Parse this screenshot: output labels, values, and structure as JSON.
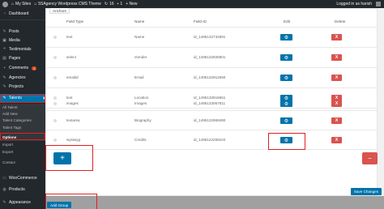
{
  "admin_bar": {
    "site_name": "My Sites",
    "theme_name": "5SAgency Wordpress CMS Theme",
    "updates_count": "16",
    "comments_count": "1",
    "new_label": "+ New",
    "greeting": "Logged in as harish"
  },
  "sidebar": {
    "items": [
      {
        "icon": "dashboard-icon",
        "label": "Dashboard"
      },
      {
        "icon": "pin-icon",
        "label": "Posts"
      },
      {
        "icon": "media-icon",
        "label": "Media"
      },
      {
        "icon": "quote-icon",
        "label": "Testimonials"
      },
      {
        "icon": "pages-icon",
        "label": "Pages"
      },
      {
        "icon": "comments-icon",
        "label": "Comments",
        "badge": "1"
      },
      {
        "icon": "agencies-icon",
        "label": "Agencies"
      },
      {
        "icon": "projects-icon",
        "label": "Projects"
      },
      {
        "icon": "talents-icon",
        "label": "Talents"
      }
    ],
    "submenu": [
      "All Talent",
      "Add New",
      "Talent Categories",
      "Talent Tags",
      "Options",
      "Import",
      "Export",
      "Contact"
    ],
    "lower_items": [
      {
        "icon": "woocommerce-icon",
        "label": "WooCommerce"
      },
      {
        "icon": "products-icon",
        "label": "Products"
      },
      {
        "icon": "appearance-icon",
        "label": "Appearance"
      }
    ]
  },
  "tab": {
    "label": "Anchors"
  },
  "table": {
    "headers": [
      "Field Type",
      "Name",
      "Field ID",
      "Edit",
      "Delete"
    ],
    "rows": [
      {
        "type": "text",
        "name": "Name",
        "id": "id_1495132732891"
      },
      {
        "type": "select",
        "name": "Gender",
        "id": "id_1495132926901"
      },
      {
        "type": "emailid",
        "name": "Email",
        "id": "id_1495132912650"
      },
      {
        "type": "text",
        "name": "Location",
        "id": "id_1495132816651"
      },
      {
        "type": "images",
        "name": "Images",
        "id": "id_1495133067811"
      },
      {
        "type": "textarea",
        "name": "Biography",
        "id": "id_1495132969480"
      },
      {
        "type": "wysiwyg",
        "name": "Credits",
        "id": "id_1496122269104"
      }
    ],
    "delete_symbol": "X"
  },
  "buttons": {
    "add_row": "+",
    "remove": "−",
    "add_group": "Add Group",
    "save_changes": "Save Changes"
  }
}
